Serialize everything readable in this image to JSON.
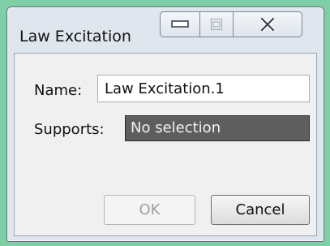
{
  "window": {
    "title": "Law Excitation"
  },
  "titlebar": {
    "buttons": [
      {
        "name": "minimize",
        "icon": "minimize-icon"
      },
      {
        "name": "maximize",
        "icon": "maximize-icon",
        "disabled": true
      },
      {
        "name": "close",
        "icon": "close-icon"
      }
    ]
  },
  "form": {
    "name_label": "Name:",
    "name_value": "Law Excitation.1",
    "supports_label": "Supports:",
    "supports_value": "No selection"
  },
  "buttons": {
    "ok_label": "OK",
    "ok_disabled": true,
    "cancel_label": "Cancel"
  },
  "colors": {
    "desktop": "#7ecfa6",
    "frame": "#dfe6ee",
    "selection_field_bg": "#5e5e5e",
    "selection_field_text": "#f2f2f2"
  }
}
